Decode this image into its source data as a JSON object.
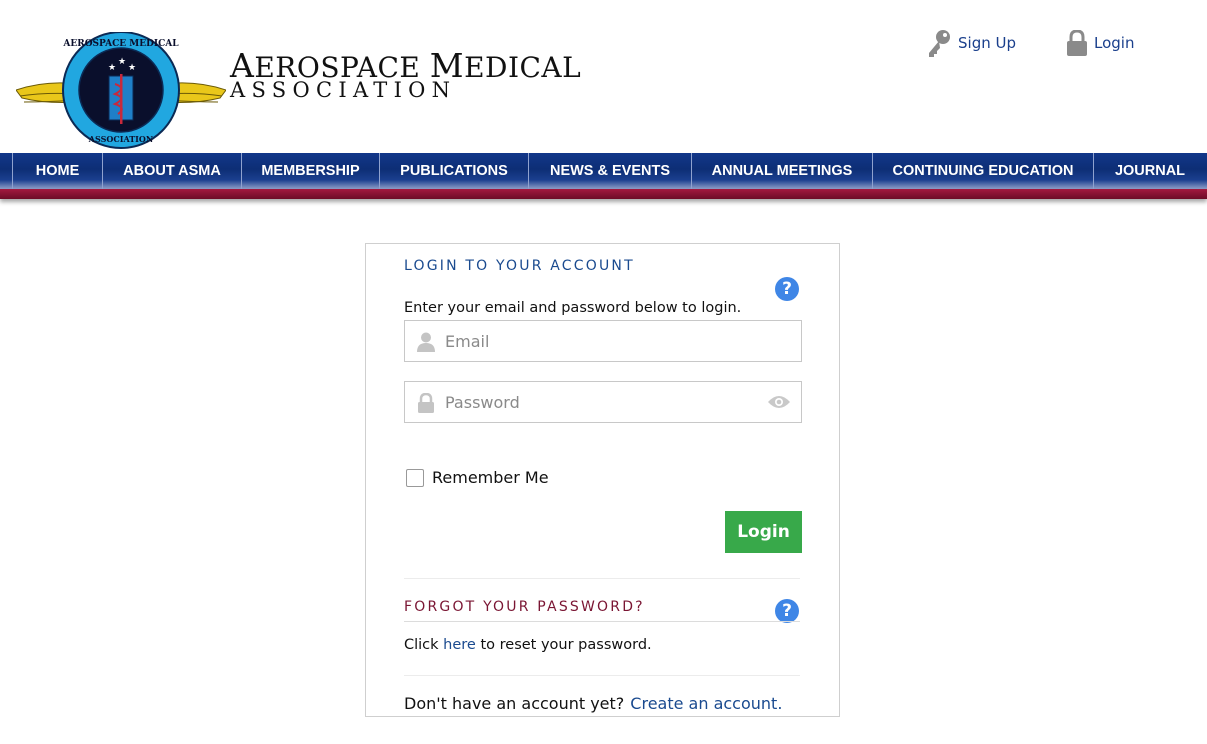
{
  "header": {
    "logo_icon": "asma-winged-seal-logo",
    "logo_ring_text_top": "AEROSPACE MEDICAL",
    "logo_ring_text_bottom": "ASSOCIATION",
    "brand_line1_cap": "A",
    "brand_line1_rest1": "EROSPACE ",
    "brand_line1_cap2": "M",
    "brand_line1_rest2": "EDICAL",
    "brand_line2": "ASSOCIATION",
    "signup_label": "Sign Up",
    "signup_icon": "key-icon",
    "login_label": "Login",
    "login_icon": "lock-icon"
  },
  "nav": {
    "items": [
      "HOME",
      "ABOUT ASMA",
      "MEMBERSHIP",
      "PUBLICATIONS",
      "NEWS & EVENTS",
      "ANNUAL MEETINGS",
      "CONTINUING EDUCATION",
      "JOURNAL"
    ]
  },
  "login": {
    "title": "LOGIN TO YOUR ACCOUNT",
    "intro": "Enter your email and password below to login.",
    "email_placeholder": "Email",
    "password_placeholder": "Password",
    "remember_label": "Remember Me",
    "button_label": "Login",
    "help_glyph": "?"
  },
  "forgot": {
    "title": "FORGOT YOUR PASSWORD?",
    "text_before": "Click ",
    "link_text": "here",
    "text_after": " to reset your password."
  },
  "signup": {
    "prompt": "Don't have an account yet?",
    "link_text": "Create an account."
  },
  "colors": {
    "nav_blue": "#0d2e75",
    "accent_crimson": "#a3193f",
    "link_blue": "#1a4a8f",
    "button_green": "#38a94a",
    "forgot_title": "#7a1533"
  }
}
